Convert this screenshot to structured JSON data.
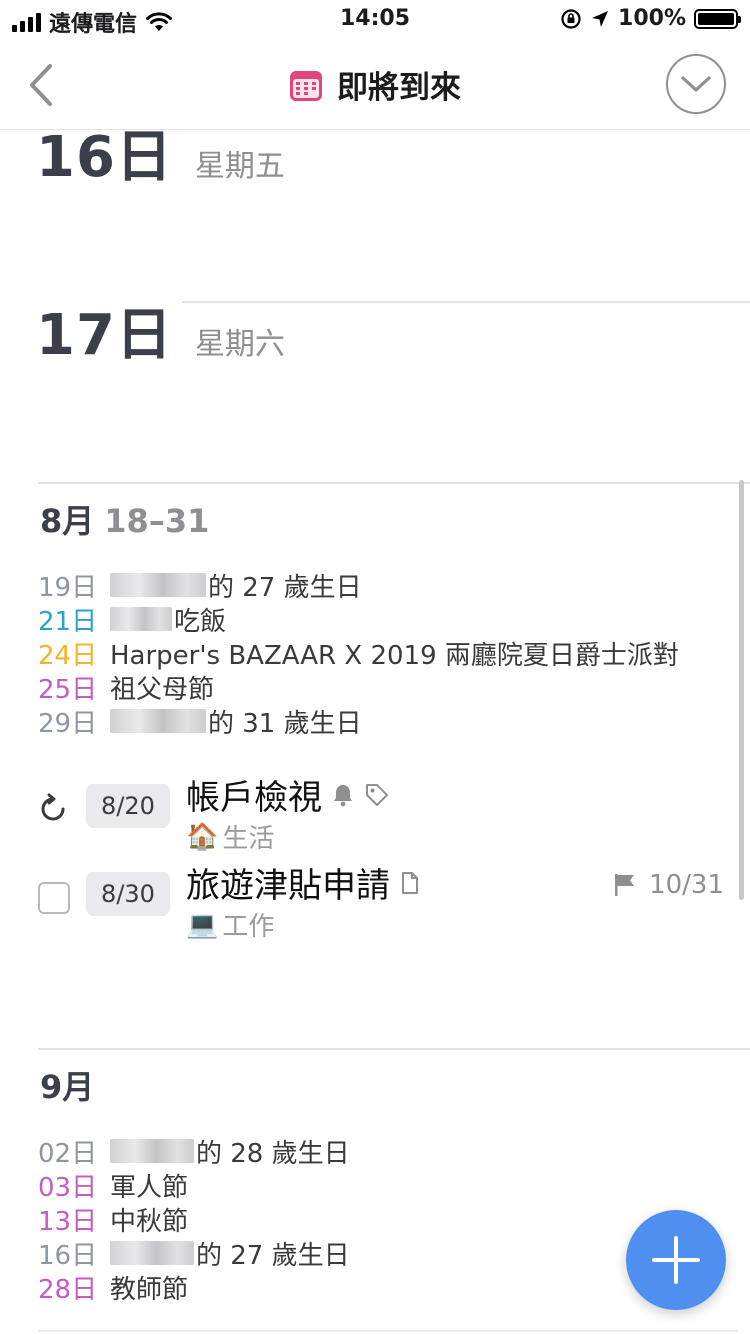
{
  "status_bar": {
    "carrier": "遠傳電信",
    "time": "14:05",
    "battery": "100%"
  },
  "nav": {
    "title": "即將到來"
  },
  "days": [
    {
      "num": "16日",
      "weekday": "星期五"
    },
    {
      "num": "17日",
      "weekday": "星期六"
    }
  ],
  "august": {
    "month": "8月",
    "range": "18–31",
    "events": [
      {
        "date": "19日",
        "pre": "",
        "text": "的 27 歲生日",
        "color": "#8e95a3"
      },
      {
        "date": "21日",
        "pre": "",
        "text": "吃飯",
        "color": "#2ba3c9"
      },
      {
        "date": "24日",
        "pre": "",
        "text": "Harper's BAZAAR X 2019 兩廳院夏日爵士派對",
        "color": "#f0b429"
      },
      {
        "date": "25日",
        "pre": "",
        "text": "祖父母節",
        "color": "#c25ec2"
      },
      {
        "date": "29日",
        "pre": "",
        "text": "的 31 歲生日",
        "color": "#8e95a3"
      }
    ],
    "tasks": [
      {
        "badge": "8/20",
        "title": "帳戶檢視",
        "emoji": "🏠",
        "list": "生活",
        "deadline": ""
      },
      {
        "badge": "8/30",
        "title": "旅遊津貼申請",
        "emoji": "💻",
        "list": "工作",
        "deadline": "10/31"
      }
    ]
  },
  "september": {
    "month": "9月",
    "events": [
      {
        "date": "02日",
        "pre": "",
        "text": "的 28 歲生日",
        "color": "#8e95a3"
      },
      {
        "date": "03日",
        "pre": "",
        "text": "軍人節",
        "color": "#c25ec2"
      },
      {
        "date": "13日",
        "pre": "",
        "text": "中秋節",
        "color": "#c25ec2"
      },
      {
        "date": "16日",
        "pre": "",
        "text": "的 27 歲生日",
        "color": "#8e95a3"
      },
      {
        "date": "28日",
        "pre": "",
        "text": "教師節",
        "color": "#c25ec2"
      }
    ]
  },
  "icons": {
    "back": "chevron-left-icon",
    "calendar": "calendar-icon",
    "check": "checkmark-circle-icon",
    "repeat": "repeat-icon",
    "bell": "bell-icon",
    "tag": "tag-icon",
    "note": "note-icon",
    "flag": "flag-icon",
    "add": "plus-icon"
  },
  "colors": {
    "accent": "#4f8ff0",
    "calendar_icon": "#e0457b"
  }
}
